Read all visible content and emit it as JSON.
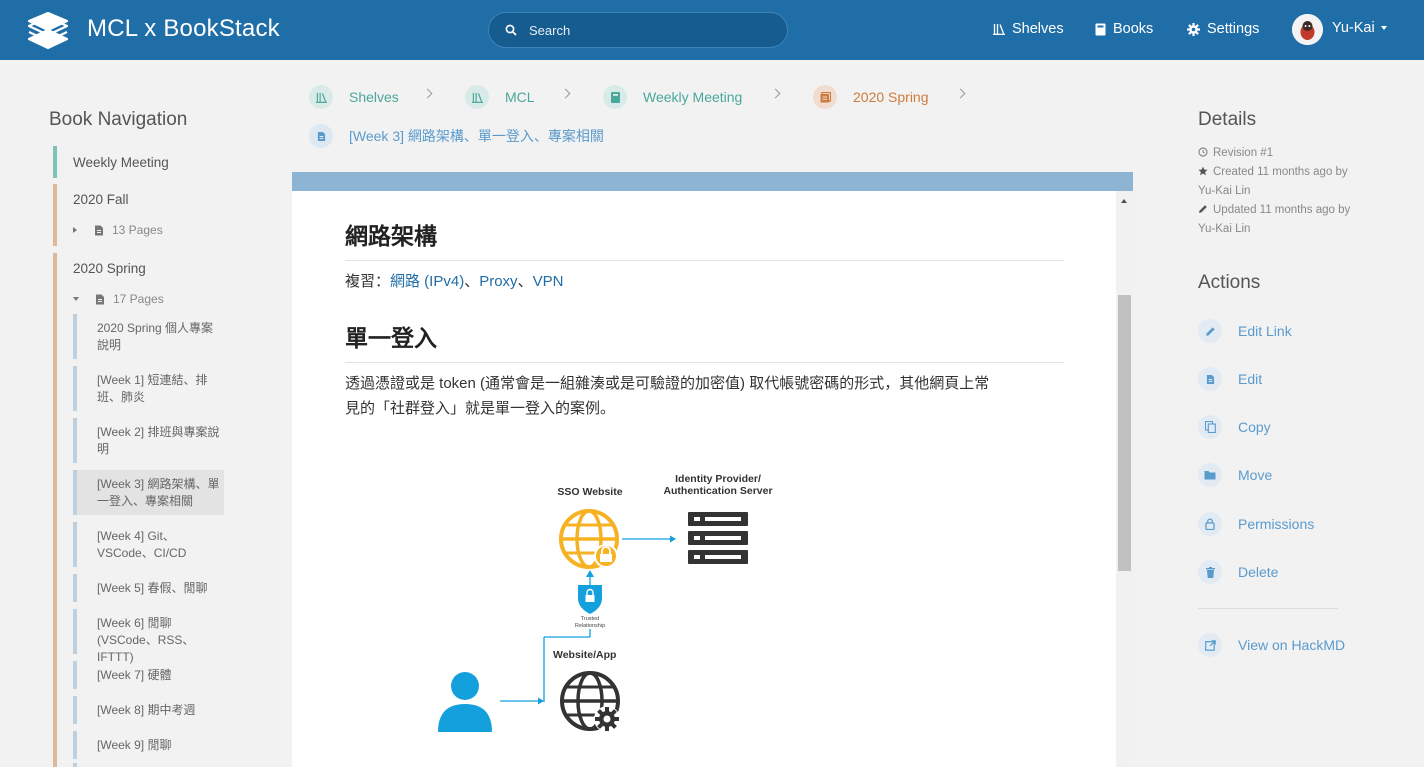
{
  "header": {
    "app_title": "MCL x BookStack",
    "search_placeholder": "Search",
    "nav": [
      {
        "label": "Shelves",
        "icon": "shelves-icon"
      },
      {
        "label": "Books",
        "icon": "books-icon"
      },
      {
        "label": "Settings",
        "icon": "gear-icon"
      }
    ],
    "user_name": "Yu-Kai"
  },
  "left": {
    "title": "Book Navigation",
    "chapter_weekly": "Weekly Meeting",
    "chapter_fall": "2020 Fall",
    "fall_pages": "13 Pages",
    "chapter_spring": "2020 Spring",
    "spring_pages": "17 Pages",
    "pages": [
      {
        "line1": "2020 Spring 個人專案",
        "line2": "說明"
      },
      {
        "line1": "[Week 1] 短連結、排",
        "line2": "班、肺炎"
      },
      {
        "line1": "[Week 2] 排班與專案說",
        "line2": "明"
      },
      {
        "line1": "[Week 3] 網路架構、單",
        "line2": "一登入、專案相關"
      },
      {
        "line1": "[Week 4] Git、",
        "line2": "VSCode、CI/CD"
      },
      {
        "line1": "[Week 5] 春假、閒聊",
        "line2": ""
      },
      {
        "line1": "[Week 6] 閒聊",
        "line2": "(VSCode、RSS、IFTTT)"
      },
      {
        "line1": "[Week 7] 硬體",
        "line2": ""
      },
      {
        "line1": "[Week 8] 期中考週",
        "line2": ""
      },
      {
        "line1": "[Week 9] 閒聊",
        "line2": ""
      }
    ]
  },
  "breadcrumbs": [
    {
      "label": "Shelves",
      "color": "#4aa89a"
    },
    {
      "label": "MCL",
      "color": "#4aa89a"
    },
    {
      "label": "Weekly Meeting",
      "color": "#4aa89a"
    },
    {
      "label": "2020 Spring",
      "color": "#cf7a3e"
    },
    {
      "label": "[Week 3] 網路架構、單一登入、專案相關",
      "color": "#5a9bcd"
    }
  ],
  "content": {
    "h_network": "網路架構",
    "review_prefix": "複習：",
    "review_link1": "網路 (IPv4)",
    "sep1": "、",
    "review_link2": "Proxy",
    "sep2": "、",
    "review_link3": "VPN",
    "h_sso": "單一登入",
    "sso_line1": "透過憑證或是 token (通常會是一組雜湊或是可驗證的加密值) 取代帳號密碼的形式，其他網頁上常",
    "sso_line2": "見的「社群登入」就是單一登入的案例。",
    "diagram": {
      "sso_website": "SSO Website",
      "idp_line1": "Identity Provider/",
      "idp_line2": "Authentication Server",
      "trusted_line1": "Trusted",
      "trusted_line2": "Relationship",
      "website_app": "Website/App"
    }
  },
  "right": {
    "details_title": "Details",
    "revision": "Revision #1",
    "created_line1": "Created 11 months ago by",
    "created_line2": "Yu-Kai Lin",
    "updated_line1": "Updated 11 months ago by",
    "updated_line2": "Yu-Kai Lin",
    "actions_title": "Actions",
    "actions": [
      "Edit Link",
      "Edit",
      "Copy",
      "Move",
      "Permissions",
      "Delete"
    ],
    "external": "View on HackMD"
  },
  "colors": {
    "header": "#206ea7",
    "shelf_green": "#4aa89a",
    "chapter_orange": "#cf7a3e",
    "page_blue": "#5a9bcd",
    "sso_yellow": "#f6b223",
    "user_blue": "#14a0dc"
  }
}
